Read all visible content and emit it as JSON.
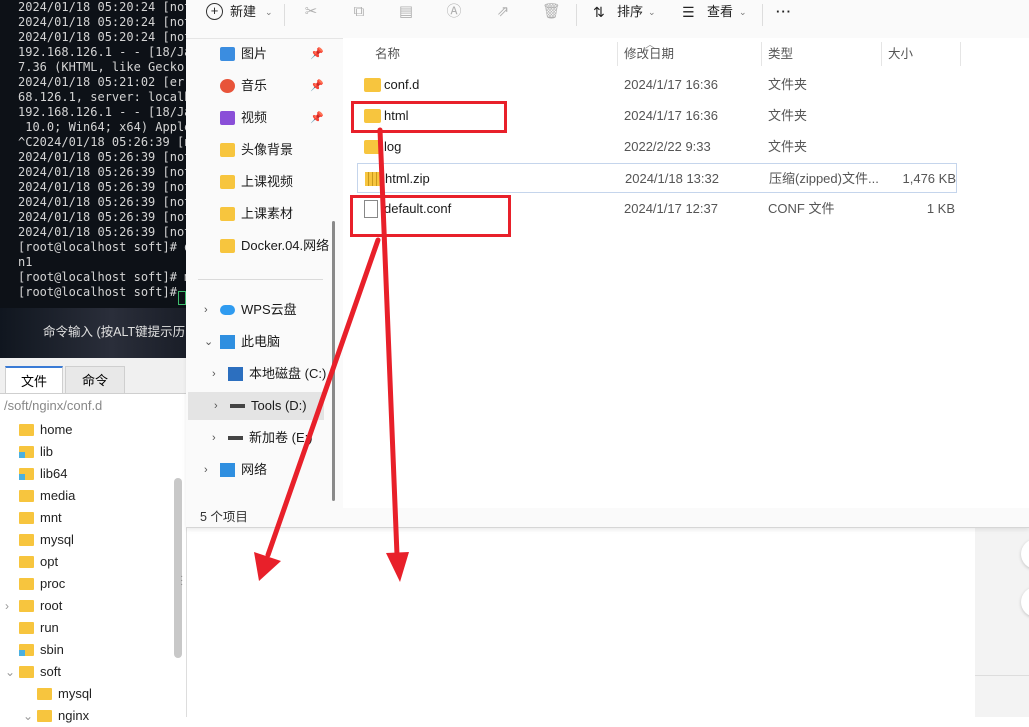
{
  "terminal": {
    "lines": [
      "2024/01/18 05:20:24 [not",
      "2024/01/18 05:20:24 [not",
      "2024/01/18 05:20:24 [not",
      "192.168.126.1 - - [18/Ja",
      "7.36 (KHTML, like Gecko)",
      "2024/01/18 05:21:02 [err",
      "68.126.1, server: localh",
      "192.168.126.1 - - [18/Ja",
      " 10.0; Win64; x64) Apple",
      "^C2024/01/18 05:26:39 [n",
      "2024/01/18 05:26:39 [not",
      "2024/01/18 05:26:39 [not",
      "2024/01/18 05:26:39 [not",
      "2024/01/18 05:26:39 [not",
      "2024/01/18 05:26:39 [not",
      "2024/01/18 05:26:39 [not",
      "[root@localhost soft]# d",
      "n1",
      "[root@localhost soft]# m",
      "[root@localhost soft]# "
    ],
    "cmd_hint": "命令输入 (按ALT键提示历"
  },
  "left_panel": {
    "tabs": [
      "文件",
      "命令"
    ],
    "path": "/soft/nginx/conf.d",
    "tree": [
      {
        "label": "home",
        "indent": 0,
        "chevron": "",
        "link": false
      },
      {
        "label": "lib",
        "indent": 0,
        "chevron": "",
        "link": true
      },
      {
        "label": "lib64",
        "indent": 0,
        "chevron": "",
        "link": true
      },
      {
        "label": "media",
        "indent": 0,
        "chevron": "",
        "link": false
      },
      {
        "label": "mnt",
        "indent": 0,
        "chevron": "",
        "link": false
      },
      {
        "label": "mysql",
        "indent": 0,
        "chevron": "",
        "link": false
      },
      {
        "label": "opt",
        "indent": 0,
        "chevron": "",
        "link": false
      },
      {
        "label": "proc",
        "indent": 0,
        "chevron": "",
        "link": false
      },
      {
        "label": "root",
        "indent": 0,
        "chevron": "›",
        "link": false
      },
      {
        "label": "run",
        "indent": 0,
        "chevron": "",
        "link": false
      },
      {
        "label": "sbin",
        "indent": 0,
        "chevron": "",
        "link": true
      },
      {
        "label": "soft",
        "indent": 0,
        "chevron": "⌄",
        "link": false
      },
      {
        "label": "mysql",
        "indent": 1,
        "chevron": "",
        "link": false
      },
      {
        "label": "nginx",
        "indent": 1,
        "chevron": "⌄",
        "link": false
      }
    ]
  },
  "toolbar": {
    "new_label": "新建",
    "sort_label": "排序",
    "view_label": "查看",
    "more_label": "···"
  },
  "nav": {
    "quick": [
      {
        "label": "图片",
        "icon": "pictures-icon",
        "pinned": true
      },
      {
        "label": "音乐",
        "icon": "music-icon",
        "pinned": true
      },
      {
        "label": "视频",
        "icon": "videos-icon",
        "pinned": true
      },
      {
        "label": "头像背景",
        "icon": "folder-icon",
        "pinned": false
      },
      {
        "label": "上课视频",
        "icon": "folder-icon",
        "pinned": false
      },
      {
        "label": "上课素材",
        "icon": "folder-icon",
        "pinned": false
      },
      {
        "label": "Docker.04.网络",
        "icon": "folder-icon",
        "pinned": false
      }
    ],
    "tree": [
      {
        "label": "WPS云盘",
        "icon": "cloud-icon",
        "chevron": "›",
        "indent": 0
      },
      {
        "label": "此电脑",
        "icon": "pc-icon",
        "chevron": "⌄",
        "indent": 0
      },
      {
        "label": "本地磁盘 (C:)",
        "icon": "drive-c-icon",
        "chevron": "›",
        "indent": 1
      },
      {
        "label": "Tools (D:)",
        "icon": "drive-icon",
        "chevron": "›",
        "indent": 1,
        "selected": true
      },
      {
        "label": "新加卷 (E:)",
        "icon": "drive-icon",
        "chevron": "›",
        "indent": 1
      },
      {
        "label": "网络",
        "icon": "network-icon",
        "chevron": "›",
        "indent": 0
      }
    ]
  },
  "columns": {
    "name": "名称",
    "date": "修改日期",
    "type": "类型",
    "size": "大小"
  },
  "files": [
    {
      "name": "conf.d",
      "date": "2024/1/17 16:36",
      "type": "文件夹",
      "size": "",
      "kind": "folder"
    },
    {
      "name": "html",
      "date": "2024/1/17 16:36",
      "type": "文件夹",
      "size": "",
      "kind": "folder"
    },
    {
      "name": "log",
      "date": "2022/2/22 9:33",
      "type": "文件夹",
      "size": "",
      "kind": "folder"
    },
    {
      "name": "html.zip",
      "date": "2024/1/18 13:32",
      "type": "压缩(zipped)文件...",
      "size": "1,476 KB",
      "kind": "zip",
      "selected": true
    },
    {
      "name": "default.conf",
      "date": "2024/1/17 12:37",
      "type": "CONF 文件",
      "size": "1 KB",
      "kind": "file"
    }
  ],
  "status": {
    "count": "5 个项目"
  },
  "colors": {
    "annotation": "#e8202a",
    "folder": "#f7c53e",
    "accent": "#3a7bd5"
  }
}
